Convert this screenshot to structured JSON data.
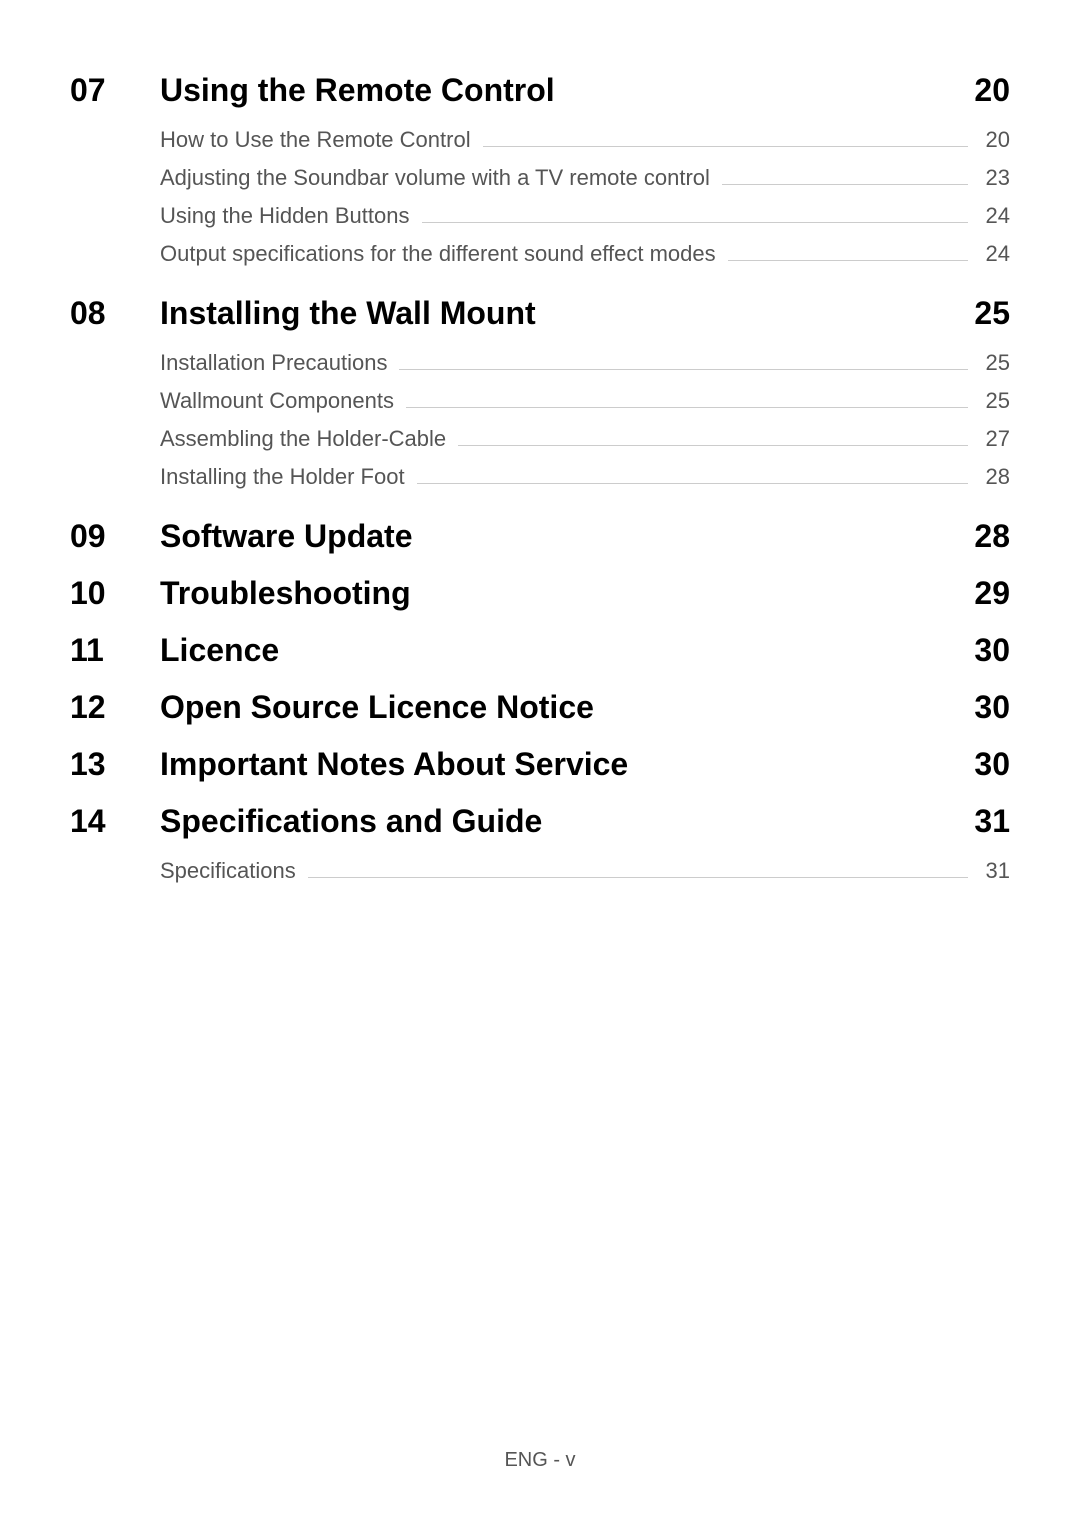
{
  "sections": [
    {
      "number": "07",
      "title": "Using the Remote Control",
      "page": "20",
      "subs": [
        {
          "title": "How to Use the Remote Control",
          "page": "20"
        },
        {
          "title": "Adjusting the Soundbar volume with a TV remote control",
          "page": "23"
        },
        {
          "title": "Using the Hidden Buttons",
          "page": "24"
        },
        {
          "title": "Output specifications for the different sound effect modes",
          "page": "24"
        }
      ]
    },
    {
      "number": "08",
      "title": "Installing the Wall Mount",
      "page": "25",
      "subs": [
        {
          "title": "Installation Precautions",
          "page": "25"
        },
        {
          "title": "Wallmount Components",
          "page": "25"
        },
        {
          "title": "Assembling the Holder-Cable",
          "page": "27"
        },
        {
          "title": "Installing the Holder Foot",
          "page": "28"
        }
      ]
    },
    {
      "number": "09",
      "title": "Software Update",
      "page": "28",
      "subs": []
    },
    {
      "number": "10",
      "title": "Troubleshooting",
      "page": "29",
      "subs": []
    },
    {
      "number": "11",
      "title": "Licence",
      "page": "30",
      "subs": []
    },
    {
      "number": "12",
      "title": "Open Source Licence Notice",
      "page": "30",
      "subs": []
    },
    {
      "number": "13",
      "title": "Important Notes About Service",
      "page": "30",
      "subs": []
    },
    {
      "number": "14",
      "title": "Specifications and Guide",
      "page": "31",
      "subs": [
        {
          "title": "Specifications",
          "page": "31"
        }
      ]
    }
  ],
  "footer": "ENG - v"
}
